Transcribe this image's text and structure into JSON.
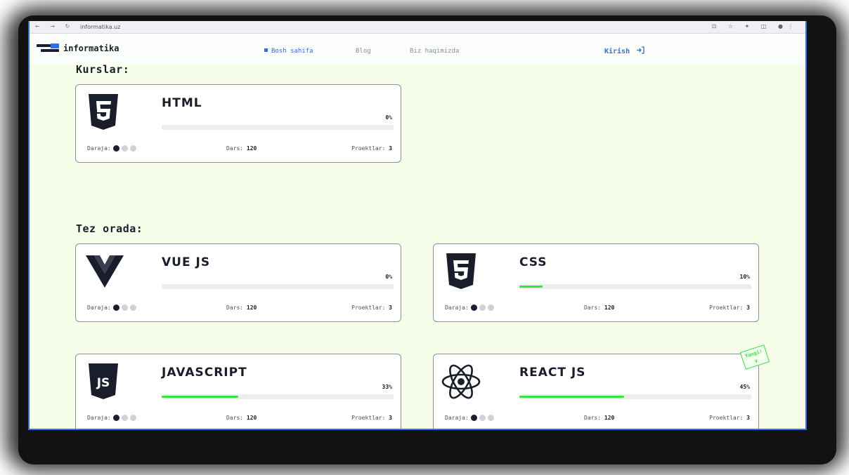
{
  "browser": {
    "url": "informatika.uz"
  },
  "header": {
    "logo_text": "informatika",
    "nav": [
      {
        "label": "Bosh sahifa",
        "active": true
      },
      {
        "label": "Blog",
        "active": false
      },
      {
        "label": "Biz haqimizda",
        "active": false
      }
    ],
    "login_label": "Kirish",
    "login_icon": "login-arrow-icon"
  },
  "sections": {
    "courses_title": "Kurslar:",
    "soon_title": "Tez orada:"
  },
  "labels": {
    "level": "Daraja:",
    "lessons": "Dars:",
    "projects": "Proektlar:"
  },
  "cards": [
    {
      "title": "HTML",
      "icon": "html5-icon",
      "progress_label": "0%",
      "progress": 0,
      "level": 1,
      "lessons": "120",
      "projects": "3"
    },
    {
      "title": "VUE JS",
      "icon": "vue-icon",
      "progress_label": "0%",
      "progress": 0,
      "level": 1,
      "lessons": "120",
      "projects": "3"
    },
    {
      "title": "CSS",
      "icon": "css3-icon",
      "progress_label": "10%",
      "progress": 10,
      "level": 1,
      "lessons": "120",
      "projects": "3"
    },
    {
      "title": "JAVASCRIPT",
      "icon": "js-icon",
      "progress_label": "33%",
      "progress": 33,
      "level": 1,
      "lessons": "120",
      "projects": "3"
    },
    {
      "title": "REACT JS",
      "icon": "react-icon",
      "progress_label": "45%",
      "progress": 45,
      "level": 1,
      "lessons": "120",
      "projects": "3"
    }
  ],
  "badge": {
    "new_label_line1": "Yangi!",
    "new_label_line2": "v"
  },
  "colors": {
    "accent": "#2f6fe0",
    "progress": "#37e63c",
    "background": "#f6fde8",
    "dark": "#1a1d2b"
  }
}
